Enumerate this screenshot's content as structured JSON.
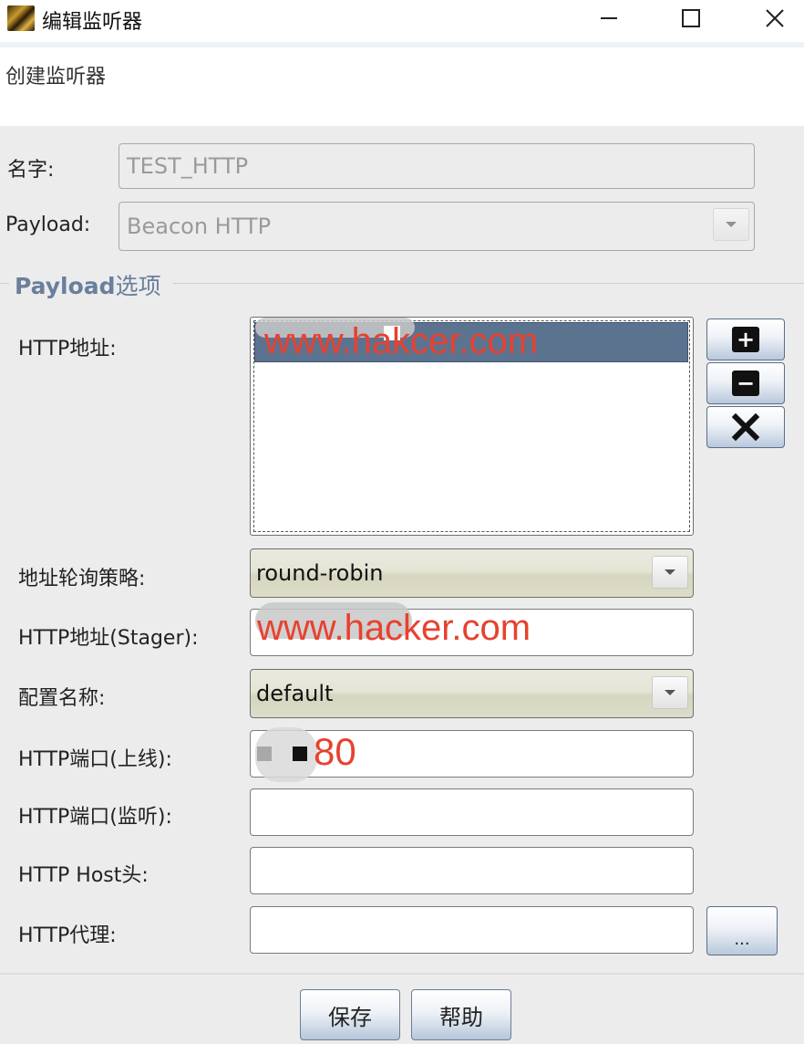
{
  "window": {
    "title": "编辑监听器",
    "description": "创建监听器"
  },
  "fields": {
    "name_label": "名字:",
    "name_value": "TEST_HTTP",
    "payload_label": "Payload:",
    "payload_value": "Beacon HTTP"
  },
  "payload_options": {
    "legend_bold": "Payload",
    "legend_rest": "选项",
    "http_hosts_label": "HTTP地址:",
    "http_hosts": [
      "www.hakcer.com"
    ],
    "rotate_label": "地址轮询策略:",
    "rotate_value": "round-robin",
    "stager_label": "HTTP地址(Stager):",
    "stager_value": "www.hacker.com",
    "profile_label": "配置名称:",
    "profile_value": "default",
    "port_c2_label": "HTTP端口(上线):",
    "port_c2_value": "80",
    "port_bind_label": "HTTP端口(监听):",
    "port_bind_value": "",
    "host_header_label": "HTTP Host头:",
    "host_header_value": "",
    "proxy_label": "HTTP代理:",
    "proxy_value": "",
    "proxy_button": "..."
  },
  "buttons": {
    "save": "保存",
    "help": "帮助"
  },
  "colors": {
    "legend": "#6a7f9c",
    "selection": "#5c7390",
    "annotation": "#e8412f"
  }
}
